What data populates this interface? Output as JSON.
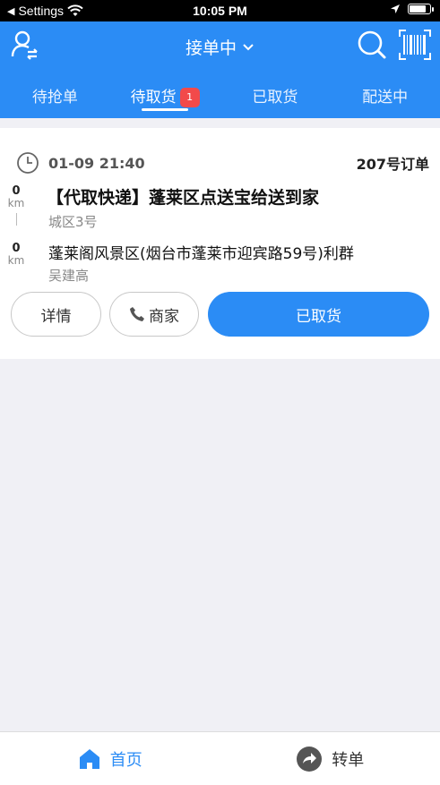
{
  "status_bar": {
    "back_label": "Settings",
    "time": "10:05 PM"
  },
  "header": {
    "title": "接单中",
    "tabs": [
      {
        "label": "待抢单"
      },
      {
        "label": "待取货",
        "badge": "1"
      },
      {
        "label": "已取货"
      },
      {
        "label": "配送中"
      }
    ]
  },
  "order": {
    "time": "01-09 21:40",
    "order_no": "207号订单",
    "pickup": {
      "distance": "0",
      "unit": "km",
      "title": "【代取快递】蓬莱区点送宝给送到家",
      "sub": "城区3号"
    },
    "dropoff": {
      "distance": "0",
      "unit": "km",
      "address": "蓬莱阁风景区(烟台市蓬莱市迎宾路59号)利群",
      "name": "吴建高"
    },
    "buttons": {
      "detail": "详情",
      "merchant": "商家",
      "picked": "已取货"
    }
  },
  "bottom_nav": {
    "home": "首页",
    "transfer": "转单"
  },
  "colors": {
    "brand": "#2b8cf5",
    "badge": "#f24a4a"
  }
}
